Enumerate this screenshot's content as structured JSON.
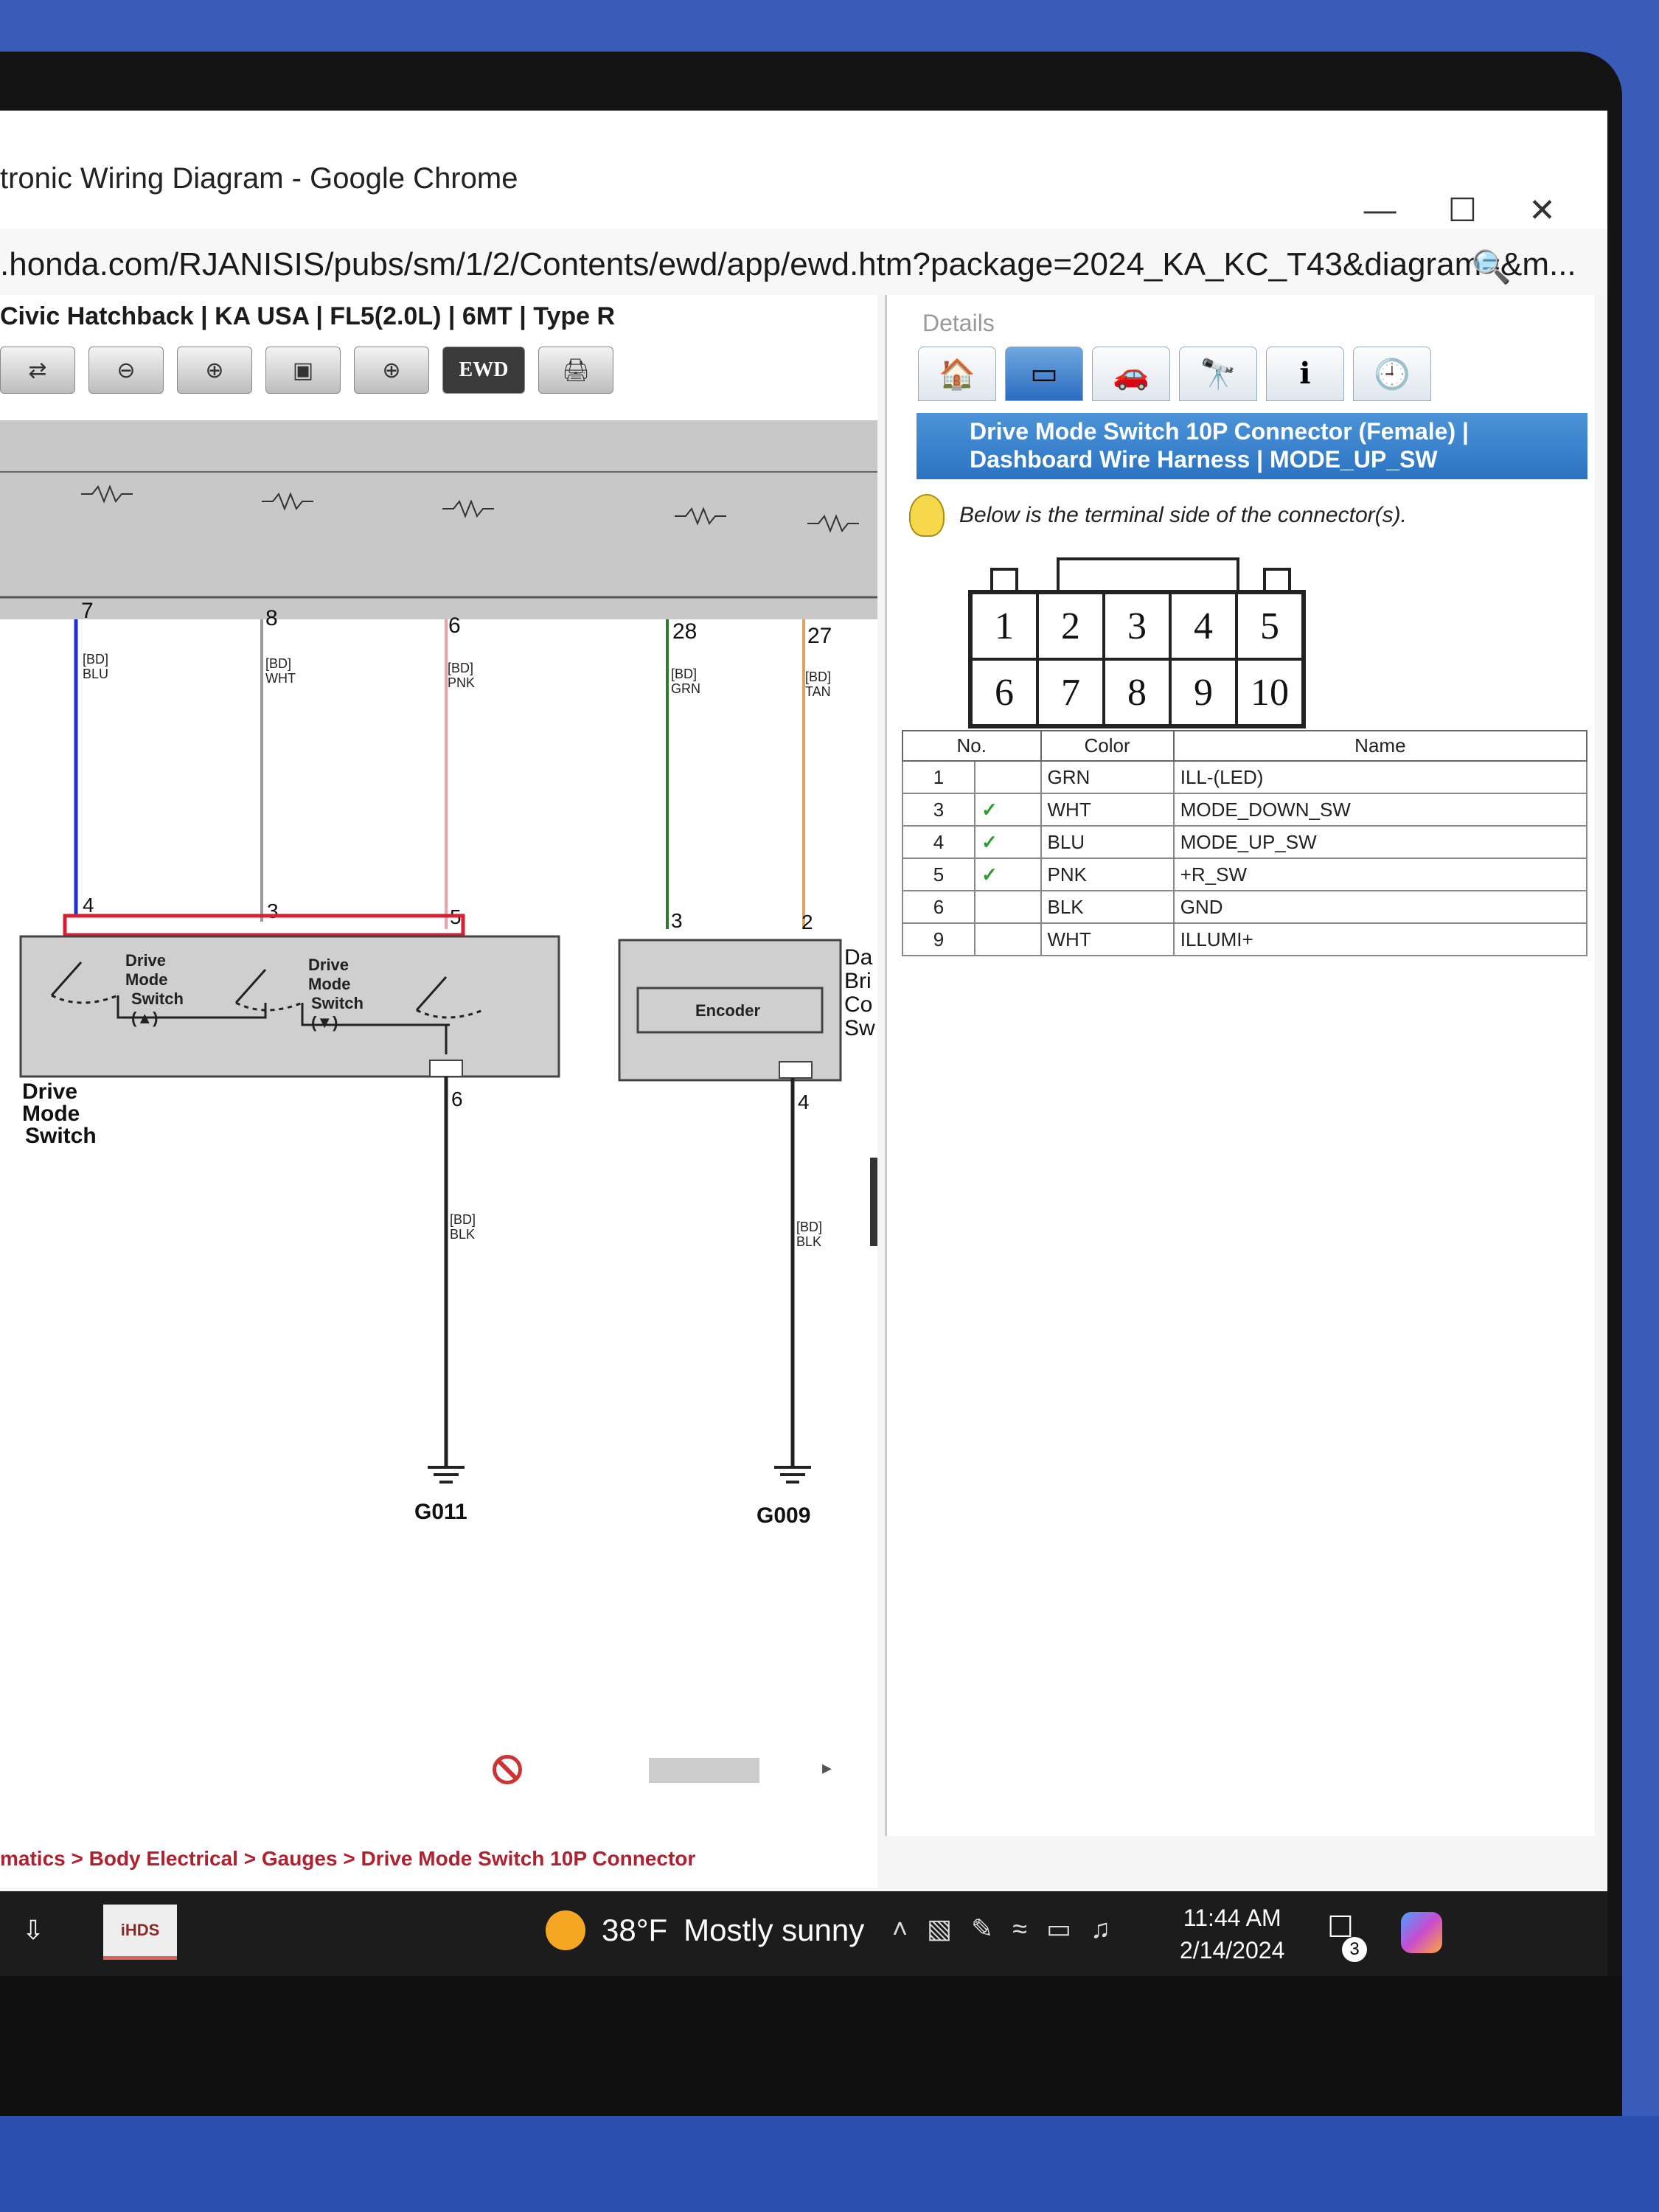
{
  "window": {
    "title": "tronic Wiring Diagram - Google Chrome",
    "url": ".honda.com/RJANISIS/pubs/sm/1/2/Contents/ewd/app/ewd.htm?package=2024_KA_KC_T43&diagram=&m...",
    "controls": [
      "—",
      "☐",
      "✕"
    ]
  },
  "left": {
    "model_line": "Civic Hatchback | KA USA | FL5(2.0L) | 6MT | Type R",
    "toolbar": [
      "⇄",
      "⊖",
      "⊕",
      "▣",
      "⊕",
      "EWD",
      "🖨"
    ],
    "ewd_label": "EWD"
  },
  "diagram": {
    "wires": [
      {
        "top_pin": "7",
        "code": "[BD]",
        "color_name": "BLU",
        "bottom_pin": "4",
        "stroke": "#1f2fd0"
      },
      {
        "top_pin": "8",
        "code": "[BD]",
        "color_name": "WHT",
        "bottom_pin": "3",
        "stroke": "#9a9a9a"
      },
      {
        "top_pin": "6",
        "code": "[BD]",
        "color_name": "PNK",
        "bottom_pin": "5",
        "stroke": "#f2a0a8"
      },
      {
        "top_pin": "28",
        "code": "[BD]",
        "color_name": "GRN",
        "bottom_pin": "3",
        "stroke": "#2f7a2f"
      },
      {
        "top_pin": "27",
        "code": "[BD]",
        "color_name": "TAN",
        "bottom_pin": "2",
        "stroke": "#e0a060"
      }
    ],
    "switch_up": {
      "line1": "Drive",
      "line2": "Mode",
      "line3": "Switch",
      "line4": "(▲)"
    },
    "switch_down": {
      "line1": "Drive",
      "line2": "Mode",
      "line3": "Switch",
      "line4": "(▼)"
    },
    "component": {
      "line1": "Drive",
      "line2": "Mode",
      "line3": "Switch"
    },
    "encoder": "Encoder",
    "cut_label": {
      "line1": "Da",
      "line2": "Bri",
      "line3": "Co",
      "line4": "Sw"
    },
    "grounds": [
      {
        "pin": "6",
        "code": "[BD]",
        "color_name": "BLK",
        "name": "G011"
      },
      {
        "pin": "4",
        "code": "[BD]",
        "color_name": "BLK",
        "name": "G009"
      }
    ]
  },
  "details": {
    "label": "Details",
    "tabs": [
      "🏠",
      "▭",
      "🚗",
      "🔭",
      "ℹ",
      "🕘"
    ],
    "header_line1": "Drive Mode Switch 10P Connector (Female) |",
    "header_line2": "Dashboard Wire Harness | MODE_UP_SW",
    "hint": "Below is the terminal side of the connector(s).",
    "pins_top": [
      "1",
      "2",
      "3",
      "4",
      "5"
    ],
    "pins_bottom": [
      "6",
      "7",
      "8",
      "9",
      "10"
    ],
    "table": {
      "headers": [
        "No.",
        "Color",
        "Name"
      ],
      "rows": [
        {
          "no": "1",
          "check": "",
          "color": "GRN",
          "name": "ILL-(LED)"
        },
        {
          "no": "3",
          "check": "✓",
          "color": "WHT",
          "name": "MODE_DOWN_SW"
        },
        {
          "no": "4",
          "check": "✓",
          "color": "BLU",
          "name": "MODE_UP_SW"
        },
        {
          "no": "5",
          "check": "✓",
          "color": "PNK",
          "name": "+R_SW"
        },
        {
          "no": "6",
          "check": "",
          "color": "BLK",
          "name": "GND"
        },
        {
          "no": "9",
          "check": "",
          "color": "WHT",
          "name": "ILLUMI+"
        }
      ]
    }
  },
  "breadcrumb": "matics > Body Electrical > Gauges > Drive Mode Switch 10P Connector",
  "taskbar": {
    "app_label": "iHDS",
    "weather_temp": "38°F",
    "weather_text": "Mostly sunny",
    "time": "11:44 AM",
    "date": "2/14/2024",
    "notifications": "3"
  }
}
